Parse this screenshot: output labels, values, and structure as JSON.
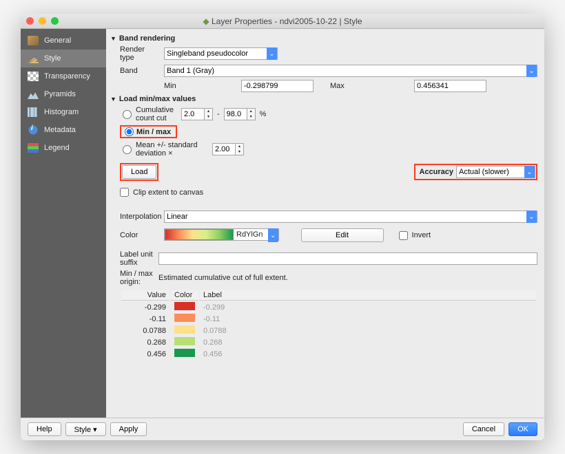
{
  "title": "Layer Properties - ndvi2005-10-22 | Style",
  "sidebar": {
    "items": [
      {
        "label": "General"
      },
      {
        "label": "Style"
      },
      {
        "label": "Transparency"
      },
      {
        "label": "Pyramids"
      },
      {
        "label": "Histogram"
      },
      {
        "label": "Metadata"
      },
      {
        "label": "Legend"
      }
    ]
  },
  "sections": {
    "band_rendering": "Band rendering",
    "load_minmax": "Load min/max values"
  },
  "labels": {
    "render_type": "Render type",
    "band": "Band",
    "min": "Min",
    "max": "Max",
    "cum_cut": "Cumulative count cut",
    "minmax": "Min / max",
    "stddev": "Mean +/- standard deviation ×",
    "load": "Load",
    "accuracy": "Accuracy",
    "clip": "Clip extent to canvas",
    "interpolation": "Interpolation",
    "color": "Color",
    "edit": "Edit",
    "invert": "Invert",
    "label_suffix": "Label unit suffix",
    "minmax_origin": "Min / max origin:",
    "origin_val": "Estimated cumulative cut of full extent.",
    "dash": "-",
    "pct": "%"
  },
  "values": {
    "render_type": "Singleband pseudocolor",
    "band": "Band 1 (Gray)",
    "min": "-0.298799",
    "max": "0.456341",
    "cum_lo": "2.0",
    "cum_hi": "98.0",
    "stddev": "2.00",
    "accuracy": "Actual (slower)",
    "interpolation": "Linear",
    "color_ramp": "RdYlGn",
    "label_suffix": ""
  },
  "color_table": {
    "headers": {
      "value": "Value",
      "color": "Color",
      "label": "Label"
    },
    "rows": [
      {
        "value": "-0.299",
        "color": "#d73027",
        "label": "-0.299"
      },
      {
        "value": "-0.11",
        "color": "#fc8d59",
        "label": "-0.11"
      },
      {
        "value": "0.0788",
        "color": "#fee08b",
        "label": "0.0788"
      },
      {
        "value": "0.268",
        "color": "#b7df71",
        "label": "0.268"
      },
      {
        "value": "0.456",
        "color": "#1a9850",
        "label": "0.456"
      }
    ]
  },
  "footer": {
    "help": "Help",
    "style": "Style ▾",
    "apply": "Apply",
    "cancel": "Cancel",
    "ok": "OK"
  }
}
